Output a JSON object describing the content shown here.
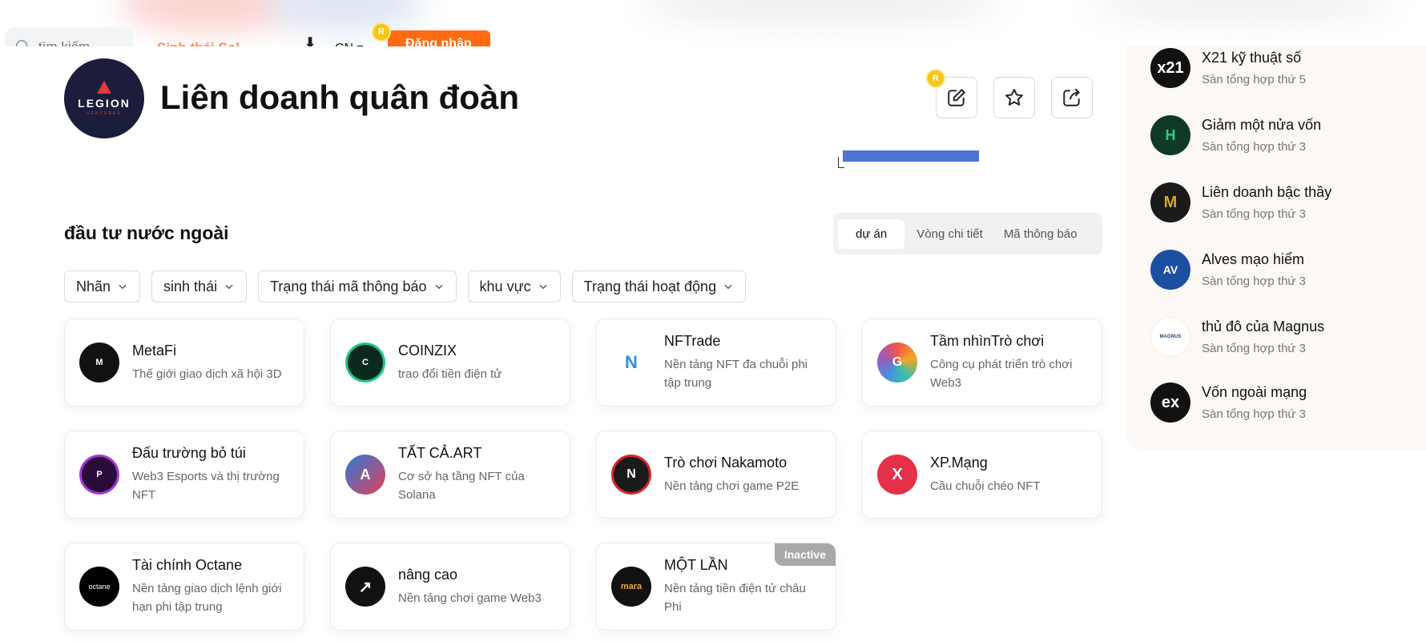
{
  "header": {
    "search_placeholder": "tìm kiếm",
    "nav_link": "Sinh thái Sol",
    "download_glyph": "⬇",
    "language": "CN ▾",
    "register_label": "Đăng nhập",
    "coin_label": "R"
  },
  "entity": {
    "logo_text": "LEGION",
    "logo_subtext": "VENTURES",
    "title": "Liên doanh quân đoàn"
  },
  "section": {
    "title": "đầu tư nước ngoài",
    "tabs": [
      {
        "label": "dự án",
        "active": true
      },
      {
        "label": "Vòng chi tiết",
        "active": false
      },
      {
        "label": "Mã thông báo",
        "active": false
      }
    ]
  },
  "filters": [
    {
      "label": "Nhãn"
    },
    {
      "label": "sinh thái"
    },
    {
      "label": "Trạng thái mã thông báo"
    },
    {
      "label": "khu vực"
    },
    {
      "label": "Trạng thái hoạt động"
    }
  ],
  "projects": [
    {
      "name": "MetaFi",
      "desc": "Thế giới giao dịch xã hội 3D",
      "logo": "M",
      "color": "#111111"
    },
    {
      "name": "COINZIX",
      "desc": "trao đổi tiền điện tử",
      "logo": "C",
      "color": "#0b2a1e"
    },
    {
      "name": "NFTrade",
      "desc": "Nền tảng NFT đa chuỗi phi tập trung",
      "logo": "N",
      "color": "#ffffff"
    },
    {
      "name": "Tầm nhìnTrò chơi",
      "desc": "Công cụ phát triển trò chơi Web3",
      "logo": "G",
      "color": "#ffffff"
    },
    {
      "name": "Đấu trường bỏ túi",
      "desc": "Web3 Esports và thị trường NFT",
      "logo": "P",
      "color": "#2a0b3a"
    },
    {
      "name": "TẤT CẢ.ART",
      "desc": "Cơ sở hạ tầng NFT của Solana",
      "logo": "A",
      "color": "#2b7bd6"
    },
    {
      "name": "Trò chơi Nakamoto",
      "desc": "Nền tảng chơi game P2E",
      "logo": "N",
      "color": "#1a1a1a"
    },
    {
      "name": "XP.Mạng",
      "desc": "Cầu chuỗi chéo NFT",
      "logo": "X",
      "color": "#e5304a"
    },
    {
      "name": "Tài chính Octane",
      "desc": "Nền tảng giao dịch lệnh giới hạn phi tập trung",
      "logo": "octane",
      "color": "#000000"
    },
    {
      "name": "nâng cao",
      "desc": "Nền tảng chơi game Web3",
      "logo": "↗",
      "color": "#111111"
    },
    {
      "name": "MỘT LẦN",
      "desc": "Nền tảng tiền điện tử châu Phi",
      "logo": "mara",
      "color": "#111111",
      "badge": "Inactive"
    }
  ],
  "sidebar": {
    "items": [
      {
        "name": "X21 kỹ thuật số",
        "sub": "Sàn tổng hợp thứ 5",
        "logo": "x21",
        "color": "#111111"
      },
      {
        "name": "Giảm một nửa vốn",
        "sub": "Sàn tổng hợp thứ 3",
        "logo": "H",
        "color": "#0e3a26"
      },
      {
        "name": "Liên doanh bậc thầy",
        "sub": "Sàn tổng hợp thứ 3",
        "logo": "M",
        "color": "#1a1a1a"
      },
      {
        "name": "Alves mạo hiểm",
        "sub": "Sàn tổng hợp thứ 3",
        "logo": "AV",
        "color": "#1d4fa0"
      },
      {
        "name": "thủ đô của Magnus",
        "sub": "Sàn tổng hợp thứ 3",
        "logo": "MAGNUS",
        "color": "#ffffff"
      },
      {
        "name": "Vốn ngoài mạng",
        "sub": "Sàn tổng hợp thứ 3",
        "logo": "ex",
        "color": "#111111"
      }
    ]
  }
}
